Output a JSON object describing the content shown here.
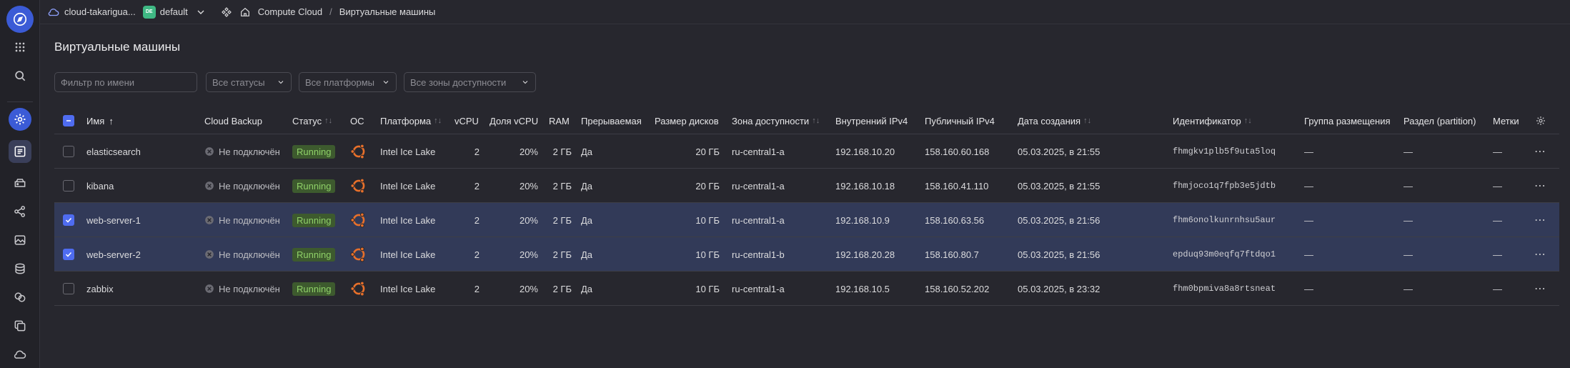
{
  "topbar": {
    "cloud_name": "cloud-takarigua...",
    "env_badge": "DE",
    "folder_name": "default",
    "service": "Compute Cloud",
    "separator": "/",
    "page": "Виртуальные машины"
  },
  "page_title": "Виртуальные машины",
  "filters": {
    "name_placeholder": "Фильтр по имени",
    "status": "Все статусы",
    "platform": "Все платформы",
    "zone": "Все зоны доступности"
  },
  "table": {
    "headers": {
      "name": "Имя",
      "name_sort": "↑",
      "backup": "Cloud Backup",
      "status": "Статус",
      "os": "ОС",
      "platform": "Платформа",
      "vcpu": "vCPU",
      "vcpu_share": "Доля vCPU",
      "ram": "RAM",
      "preemptible": "Прерываемая",
      "disk": "Размер дисков",
      "zone": "Зона доступности",
      "internal_ip": "Внутренний IPv4",
      "public_ip": "Публичный IPv4",
      "created": "Дата создания",
      "id": "Идентификатор",
      "placement": "Группа размещения",
      "partition": "Раздел (partition)",
      "labels": "Метки"
    },
    "rows": [
      {
        "selected": false,
        "name": "elasticsearch",
        "backup": "Не подключён",
        "status": "Running",
        "platform": "Intel Ice Lake",
        "vcpu": "2",
        "share": "20%",
        "ram": "2 ГБ",
        "preemptible": "Да",
        "disk": "20 ГБ",
        "zone": "ru-central1-a",
        "internal_ip": "192.168.10.20",
        "public_ip": "158.160.60.168",
        "created": "05.03.2025, в 21:55",
        "id": "fhmgkv1plb5f9uta5loq",
        "placement": "—",
        "partition": "—",
        "labels": "—"
      },
      {
        "selected": false,
        "name": "kibana",
        "backup": "Не подключён",
        "status": "Running",
        "platform": "Intel Ice Lake",
        "vcpu": "2",
        "share": "20%",
        "ram": "2 ГБ",
        "preemptible": "Да",
        "disk": "20 ГБ",
        "zone": "ru-central1-a",
        "internal_ip": "192.168.10.18",
        "public_ip": "158.160.41.110",
        "created": "05.03.2025, в 21:55",
        "id": "fhmjoco1q7fpb3e5jdtb",
        "placement": "—",
        "partition": "—",
        "labels": "—"
      },
      {
        "selected": true,
        "name": "web-server-1",
        "backup": "Не подключён",
        "status": "Running",
        "platform": "Intel Ice Lake",
        "vcpu": "2",
        "share": "20%",
        "ram": "2 ГБ",
        "preemptible": "Да",
        "disk": "10 ГБ",
        "zone": "ru-central1-a",
        "internal_ip": "192.168.10.9",
        "public_ip": "158.160.63.56",
        "created": "05.03.2025, в 21:56",
        "id": "fhm6onolkunrnhsu5aur",
        "placement": "—",
        "partition": "—",
        "labels": "—"
      },
      {
        "selected": true,
        "name": "web-server-2",
        "backup": "Не подключён",
        "status": "Running",
        "platform": "Intel Ice Lake",
        "vcpu": "2",
        "share": "20%",
        "ram": "2 ГБ",
        "preemptible": "Да",
        "disk": "10 ГБ",
        "zone": "ru-central1-b",
        "internal_ip": "192.168.20.28",
        "public_ip": "158.160.80.7",
        "created": "05.03.2025, в 21:56",
        "id": "epduq93m0eqfq7ftdqo1",
        "placement": "—",
        "partition": "—",
        "labels": "—"
      },
      {
        "selected": false,
        "name": "zabbix",
        "backup": "Не подключён",
        "status": "Running",
        "platform": "Intel Ice Lake",
        "vcpu": "2",
        "share": "20%",
        "ram": "2 ГБ",
        "preemptible": "Да",
        "disk": "10 ГБ",
        "zone": "ru-central1-a",
        "internal_ip": "192.168.10.5",
        "public_ip": "158.160.52.202",
        "created": "05.03.2025, в 23:32",
        "id": "fhm0bpmiva8a8rtsneat",
        "placement": "—",
        "partition": "—",
        "labels": "—"
      }
    ]
  },
  "colors": {
    "background": "#27272e",
    "accent": "#4f6cf0",
    "selected_row": "#323a58",
    "status_running_bg": "#3d5a2e",
    "status_running_fg": "#8fd168",
    "ubuntu_orange": "#e8702a",
    "env_badge": "#3fb884"
  },
  "icons": {
    "rail": [
      "compass-logo-icon",
      "grid-icon",
      "search-icon",
      "gear-icon",
      "list-icon",
      "database-icon",
      "network-icon",
      "image-icon",
      "layers-icon",
      "coins-icon",
      "copy-icon",
      "cloud-icon"
    ],
    "os": "ubuntu-icon",
    "backup": "disconnected-icon"
  }
}
